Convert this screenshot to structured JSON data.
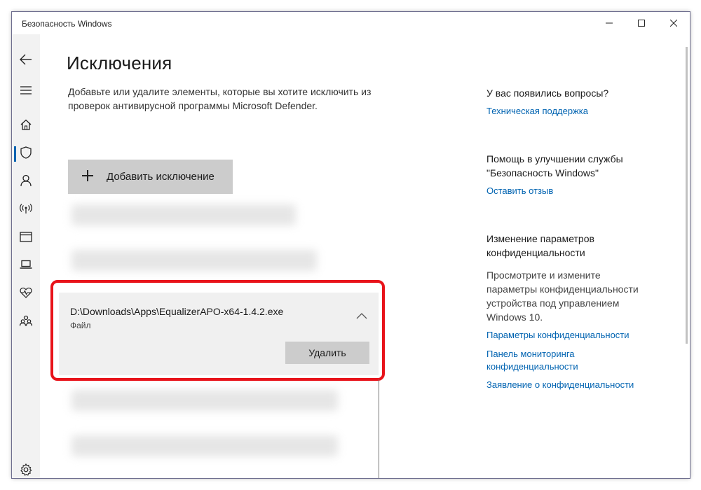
{
  "window": {
    "title": "Безопасность Windows"
  },
  "sidebar": {
    "items": [
      {
        "name": "back-icon"
      },
      {
        "name": "menu-icon"
      },
      {
        "name": "home-icon"
      },
      {
        "name": "shield-icon",
        "active": true
      },
      {
        "name": "account-icon"
      },
      {
        "name": "network-icon"
      },
      {
        "name": "app-browser-icon"
      },
      {
        "name": "device-security-icon"
      },
      {
        "name": "device-health-icon"
      },
      {
        "name": "family-icon"
      },
      {
        "name": "settings-icon"
      }
    ]
  },
  "main": {
    "title": "Исключения",
    "description": "Добавьте или удалите элементы, которые вы хотите исключить из проверок антивирусной программы Microsoft Defender.",
    "add_button_label": "Добавить исключение",
    "exclusion": {
      "path": "D:\\Downloads\\Apps\\EqualizerAPO-x64-1.4.2.exe",
      "type": "Файл",
      "delete_label": "Удалить"
    }
  },
  "right_panel": {
    "questions_heading": "У вас появились вопросы?",
    "support_link": "Техническая поддержка",
    "improve_heading_line1": "Помощь в улучшении службы",
    "improve_heading_line2": "\"Безопасность Windows\"",
    "feedback_link": "Оставить отзыв",
    "privacy_heading_line1": "Изменение параметров",
    "privacy_heading_line2": "конфиденциальности",
    "privacy_text": "Просмотрите и измените параметры конфиденциальности устройства под управлением Windows 10.",
    "privacy_settings_link": "Параметры конфиденциальности",
    "privacy_dashboard_link_line1": "Панель мониторинга",
    "privacy_dashboard_link_line2": "конфиденциальности",
    "privacy_statement_link": "Заявление о конфиденциальности"
  },
  "colors": {
    "accent": "#0063b1",
    "highlight": "#e8131a"
  }
}
